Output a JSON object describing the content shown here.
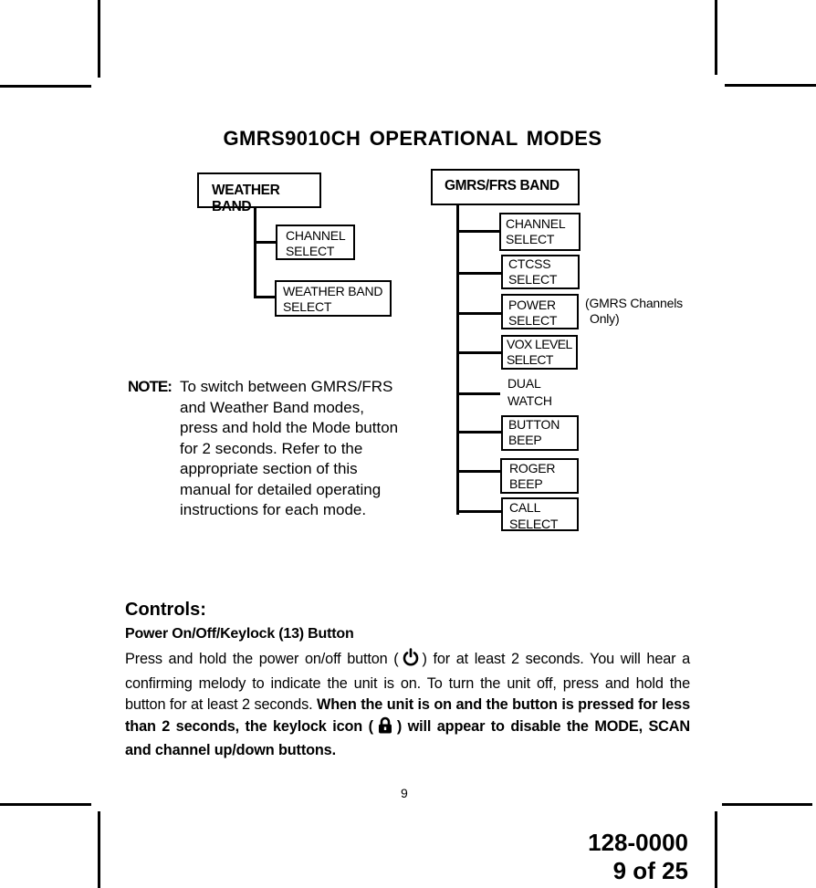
{
  "title": "GMRS9010CH OPERATIONAL MODES",
  "weather_band": {
    "header": "WEATHER BAND",
    "items": [
      {
        "line1": "CHANNEL",
        "line2": "SELECT"
      },
      {
        "line1": "WEATHER BAND",
        "line2": "SELECT"
      }
    ]
  },
  "gmrs_frs_band": {
    "header": "GMRS/FRS BAND",
    "items": [
      {
        "line1": "CHANNEL",
        "line2": "SELECT",
        "boxed": true
      },
      {
        "line1": "CTCSS",
        "line2": "SELECT",
        "boxed": true
      },
      {
        "line1": "POWER",
        "line2": "SELECT",
        "boxed": true
      },
      {
        "line1": "VOX LEVEL",
        "line2": "SELECT",
        "boxed": true
      },
      {
        "line1": "DUAL",
        "line2": "WATCH",
        "boxed": false
      },
      {
        "line1": "BUTTON",
        "line2": "BEEP",
        "boxed": true
      },
      {
        "line1": "ROGER",
        "line2": "BEEP",
        "boxed": true
      },
      {
        "line1": "CALL",
        "line2": "SELECT",
        "boxed": true
      }
    ],
    "power_note_line1": "(GMRS Channels",
    "power_note_line2": "Only)"
  },
  "note": {
    "label": "NOTE:",
    "lines": [
      "To switch between GMRS/FRS",
      "and Weather Band modes,",
      "press and hold the Mode button",
      "for 2 seconds. Refer to the",
      "appropriate section of this",
      "manual for detailed operating",
      "instructions for each mode."
    ]
  },
  "controls": {
    "heading": "Controls:",
    "subheading": "Power On/Off/Keylock (13) Button",
    "para_part1": "Press and hold the power on/off button (",
    "power_icon": "power-icon",
    "para_part2": ") for at least 2 seconds. You will hear a confirming melody to indicate the unit is on. To turn the unit off, press and hold the button for at least 2 seconds. ",
    "bold_part1": "When the unit is on and the button is pressed for less than 2 seconds, the keylock icon (",
    "lock_icon": "lock-icon",
    "bold_part2": ") will appear to disable the MODE, SCAN and channel up/down buttons."
  },
  "footer": {
    "page_number": "9",
    "doc_number": "128-0000",
    "page_of": "9 of 25"
  }
}
